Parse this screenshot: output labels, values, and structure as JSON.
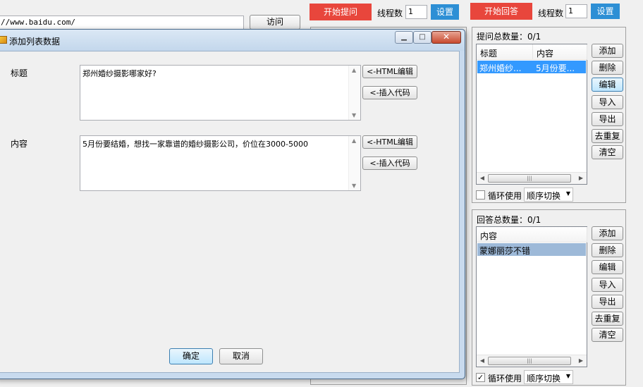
{
  "browser": {
    "url": "//www.baidu.com/",
    "visit_label": "访问"
  },
  "question_toolbar": {
    "start_label": "开始提问",
    "thread_label": "线程数",
    "thread_value": "1",
    "settings_label": "设置"
  },
  "answer_toolbar": {
    "start_label": "开始回答",
    "thread_label": "线程数",
    "thread_value": "1",
    "settings_label": "设置"
  },
  "question_panel": {
    "count_label": "提问总数量：0/1",
    "columns": [
      "标题",
      "内容"
    ],
    "rows": [
      {
        "title": "郑州婚纱...",
        "content": "5月份要..."
      }
    ],
    "buttons": {
      "add": "添加",
      "delete": "删除",
      "edit": "编辑",
      "import": "导入",
      "export": "导出",
      "dedupe": "去重复",
      "clear": "清空"
    },
    "loop_label": "循环使用",
    "loop_checked": false,
    "order_value": "顺序切换"
  },
  "answer_panel": {
    "count_label": "回答总数量：0/1",
    "columns": [
      "内容"
    ],
    "rows": [
      {
        "content": "蒙娜丽莎不错"
      }
    ],
    "buttons": {
      "add": "添加",
      "delete": "删除",
      "edit": "编辑",
      "import": "导入",
      "export": "导出",
      "dedupe": "去重复",
      "clear": "清空"
    },
    "loop_label": "循环使用",
    "loop_checked": true,
    "order_value": "顺序切换"
  },
  "dialog": {
    "title": "添加列表数据",
    "title_label": "标题",
    "title_value": "郑州婚纱摄影哪家好?",
    "content_label": "内容",
    "content_value": "5月份要结婚，想找一家靠谱的婚纱摄影公司，价位在3000-5000",
    "html_edit_label": "<-HTML编辑",
    "insert_code_label": "<-插入代码",
    "ok_label": "确定",
    "cancel_label": "取消"
  },
  "colors": {
    "start_button": "#e8463c",
    "settings_button": "#2d8fd5",
    "selection": "#3399ff"
  }
}
